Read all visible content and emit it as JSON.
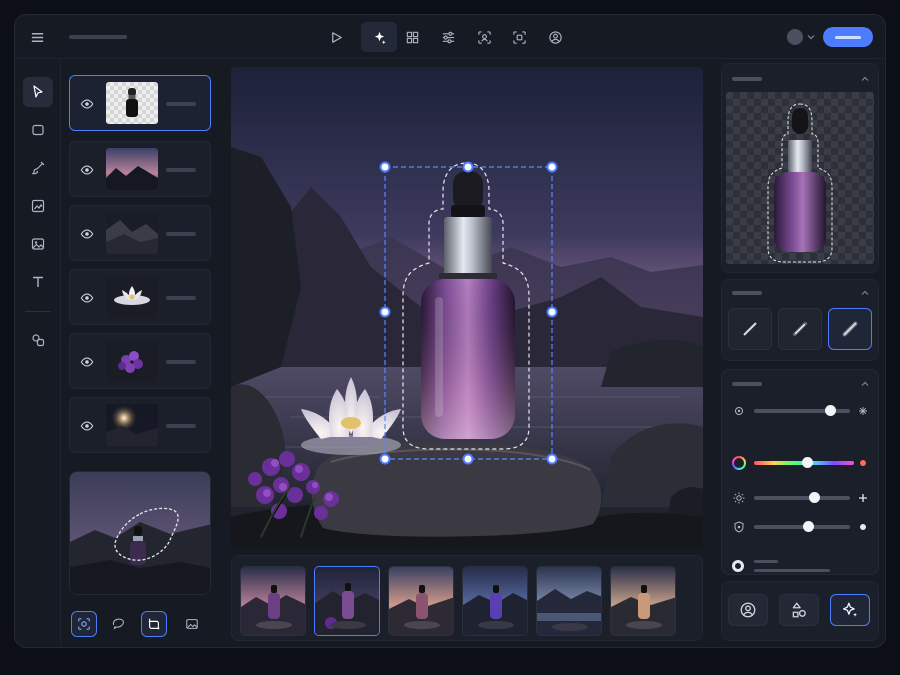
{
  "app": {
    "accent": "#4c7dff",
    "bg": "#161a23"
  },
  "topbar": {
    "menu_icon": "hamburger-icon",
    "tools": [
      "play-icon",
      "magic-sparkle-icon",
      "layout-grid-icon",
      "sliders-icon",
      "face-scan-icon",
      "object-select-icon",
      "user-circle-icon"
    ],
    "active_tool_index": 1,
    "avatar": "avatar-dot",
    "primary_button_label": ""
  },
  "leftbar": {
    "tools": [
      "cursor-icon",
      "rectangle-icon",
      "brush-icon",
      "image-adjust-icon",
      "image-icon",
      "text-icon",
      "shapes-icon"
    ],
    "active_tool_index": 0
  },
  "layers": [
    {
      "name": "product-bottle-cutout",
      "visible": true,
      "selected": true
    },
    {
      "name": "sky-background",
      "visible": true
    },
    {
      "name": "rocks",
      "visible": true
    },
    {
      "name": "lotus-flower",
      "visible": true
    },
    {
      "name": "purple-flowers",
      "visible": true
    },
    {
      "name": "glow-light",
      "visible": true
    }
  ],
  "mask_tools": [
    "lasso-select-icon",
    "ellipse-select-icon",
    "crop-transform-icon",
    "image-icon"
  ],
  "mask_tools_active_index": 2,
  "filmstrip": {
    "count": 6,
    "selected_index": 1
  },
  "right_panel": {
    "sections": [
      "cutout-preview",
      "brush-style",
      "adjustments"
    ],
    "brush_styles": [
      "solid-brush",
      "soft-brush",
      "airbrush"
    ],
    "brush_selected_index": 2,
    "sliders": [
      {
        "icon": "contrast-icon",
        "value": 0.8
      },
      {
        "icon": "color-wheel-icon",
        "value": 0.52,
        "gradient": true
      },
      {
        "icon": "sun-icon",
        "value": 0.6
      },
      {
        "icon": "shield-icon",
        "value": 0.53
      }
    ],
    "bottom_actions": [
      "user-circle-icon",
      "swap-shapes-icon",
      "magic-sparkle-icon"
    ],
    "bottom_selected_index": 2
  }
}
